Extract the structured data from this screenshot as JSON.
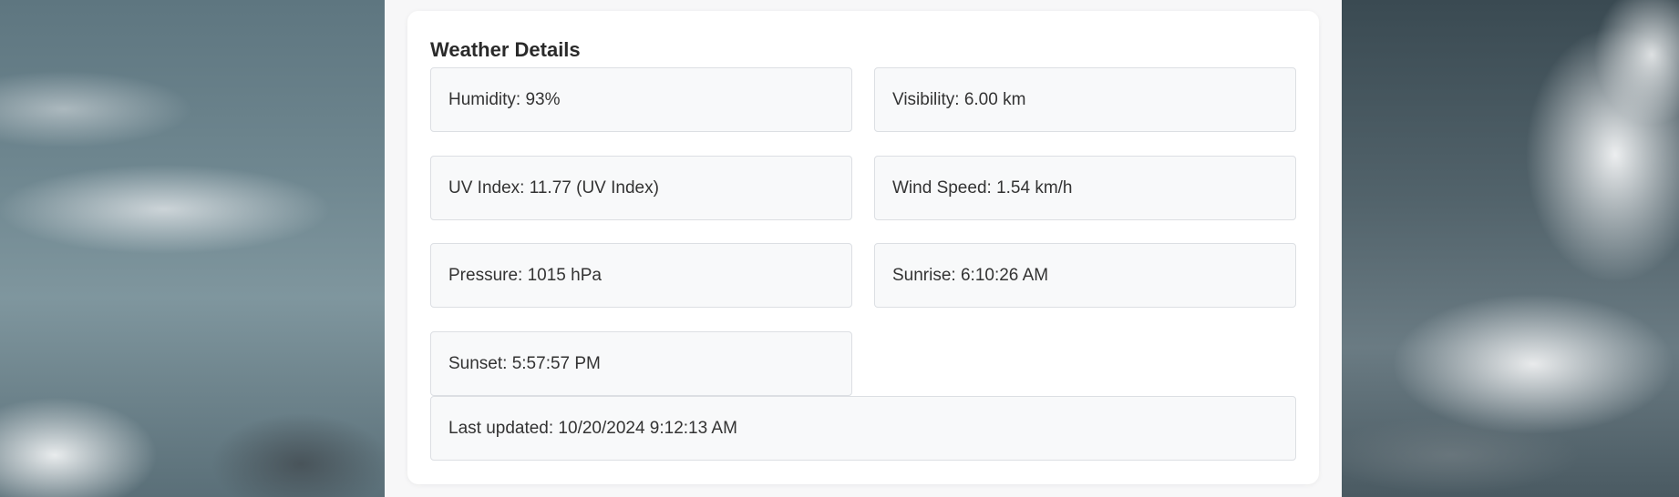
{
  "weather_details": {
    "title": "Weather Details",
    "items": [
      {
        "label": "Humidity: 93%"
      },
      {
        "label": "Visibility: 6.00 km"
      },
      {
        "label": "UV Index: 11.77 (UV Index)"
      },
      {
        "label": "Wind Speed: 1.54 km/h"
      },
      {
        "label": "Pressure: 1015 hPa"
      },
      {
        "label": "Sunrise: 6:10:26 AM"
      },
      {
        "label": "Sunset: 5:57:57 PM"
      }
    ],
    "last_updated": "Last updated: 10/20/2024 9:12:13 AM"
  }
}
